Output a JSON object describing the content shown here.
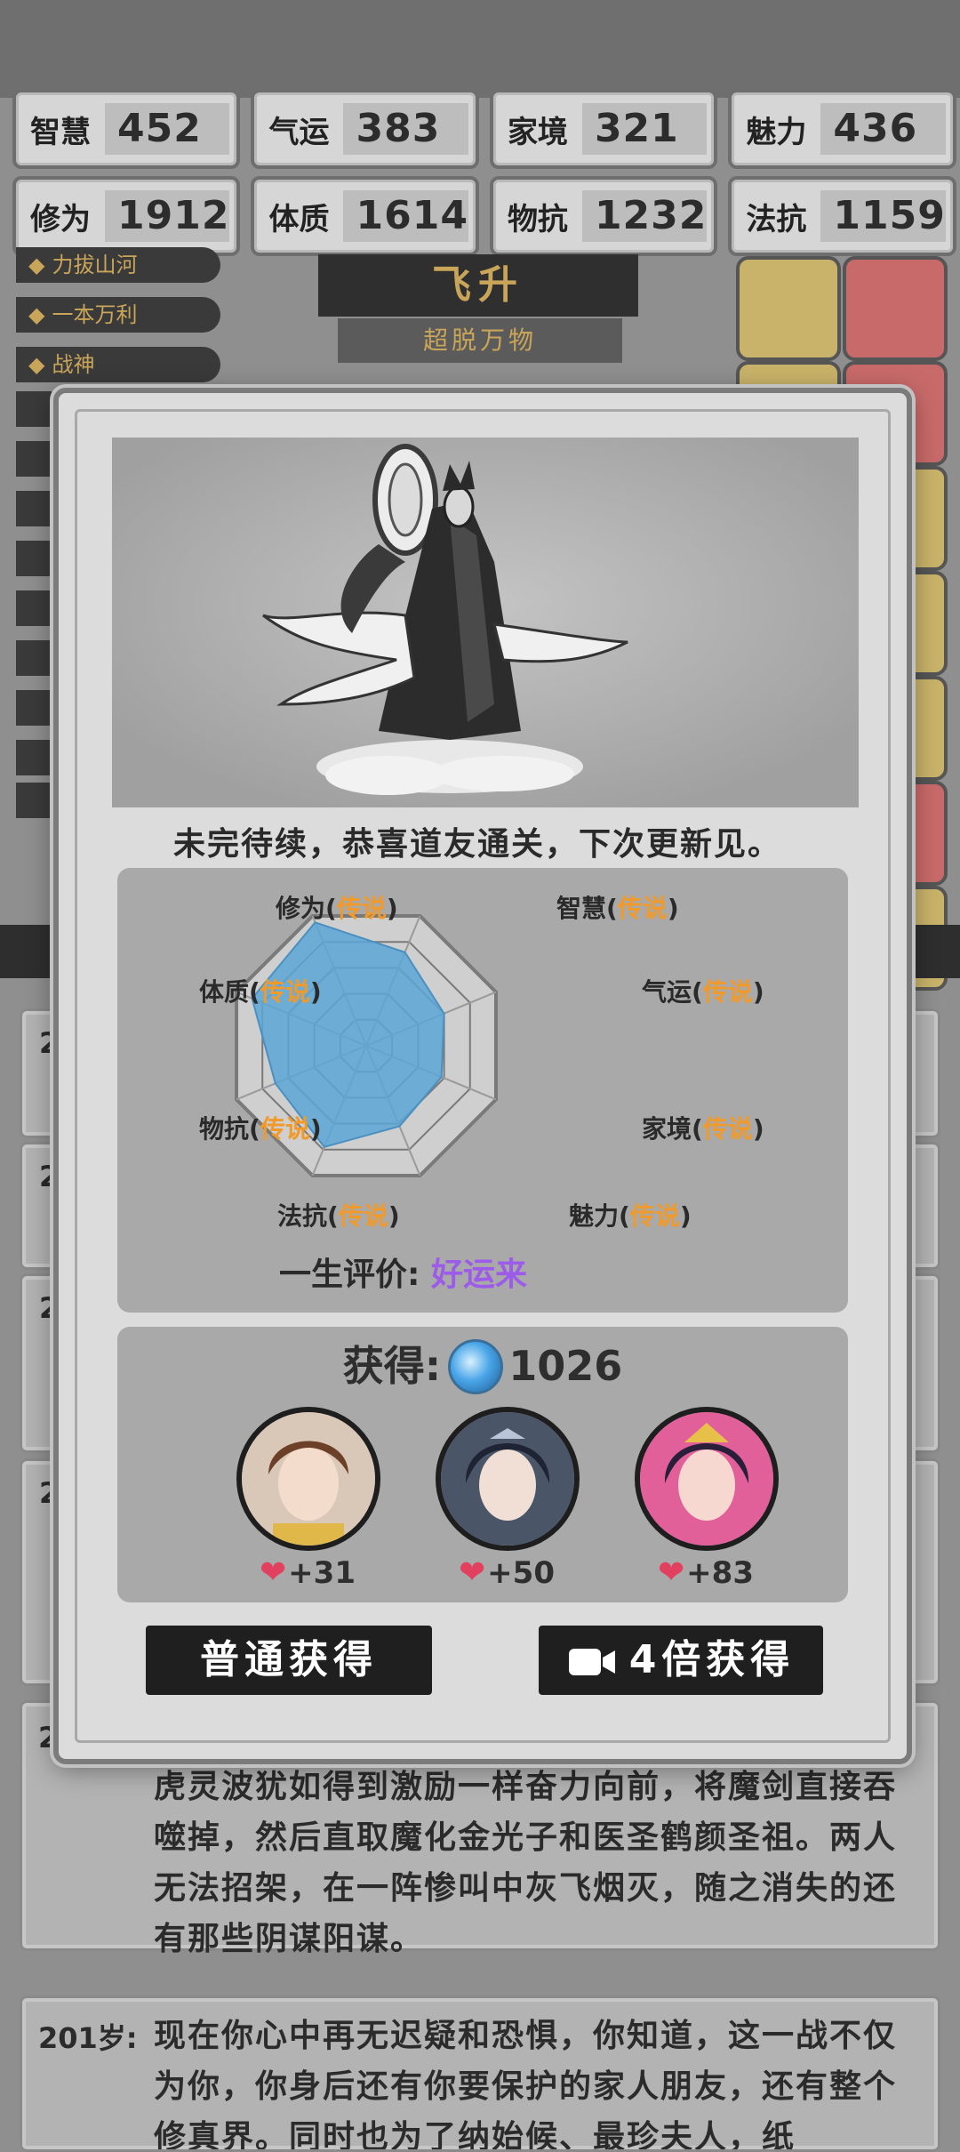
{
  "stats": [
    {
      "name": "智慧",
      "value": "452"
    },
    {
      "name": "气运",
      "value": "383"
    },
    {
      "name": "家境",
      "value": "321"
    },
    {
      "name": "魅力",
      "value": "436"
    },
    {
      "name": "修为",
      "value": "1912"
    },
    {
      "name": "体质",
      "value": "1614"
    },
    {
      "name": "物抗",
      "value": "1232"
    },
    {
      "name": "法抗",
      "value": "1159"
    }
  ],
  "background": {
    "title": "飞升",
    "subtitle": "超脱万物",
    "tags": [
      "力拔山河",
      "一本万利",
      "战神"
    ],
    "card_numbers": [
      "2",
      "2",
      "2",
      "2"
    ],
    "story_card": {
      "number": "2",
      "text": "虎灵波犹如得到激励一样奋力向前，将魔剑直接吞噬掉，然后直取魔化金光子和医圣鹤颜圣祖。两人无法招架，在一阵惨叫中灰飞烟灭，随之消失的还有那些阴谋阳谋。"
    },
    "age_card": {
      "age": "201岁:",
      "text": "现在你心中再无迟疑和恐惧，你知道，这一战不仅为你，你身后还有你要保护的家人朋友，还有整个修真界。同时也为了纳始候、最珍夫人，纸"
    }
  },
  "modal": {
    "ending_text": "未完待续，恭喜道友通关，下次更新见。",
    "radar": {
      "labels": [
        {
          "stat": "修为",
          "quality": "传说"
        },
        {
          "stat": "智慧",
          "quality": "传说"
        },
        {
          "stat": "气运",
          "quality": "传说"
        },
        {
          "stat": "家境",
          "quality": "传说"
        },
        {
          "stat": "魅力",
          "quality": "传说"
        },
        {
          "stat": "法抗",
          "quality": "传说"
        },
        {
          "stat": "物抗",
          "quality": "传说"
        },
        {
          "stat": "体质",
          "quality": "传说"
        }
      ],
      "values": [
        0.95,
        0.72,
        0.6,
        0.58,
        0.62,
        0.78,
        0.7,
        0.88
      ],
      "fill_color": "#5aa6d6"
    },
    "evaluation": {
      "label": "一生评价:",
      "value": "好运来"
    },
    "reward": {
      "label": "获得:",
      "amount": "1026",
      "characters": [
        {
          "affinity": "+31"
        },
        {
          "affinity": "+50"
        },
        {
          "affinity": "+83"
        }
      ]
    },
    "buttons": {
      "normal": "普通获得",
      "ad": "4倍获得"
    }
  },
  "colors": {
    "quality": "#f19a2c",
    "evaluation": "#9c5be8",
    "heart": "#e2405f",
    "accent_gold": "#c9a55a"
  }
}
